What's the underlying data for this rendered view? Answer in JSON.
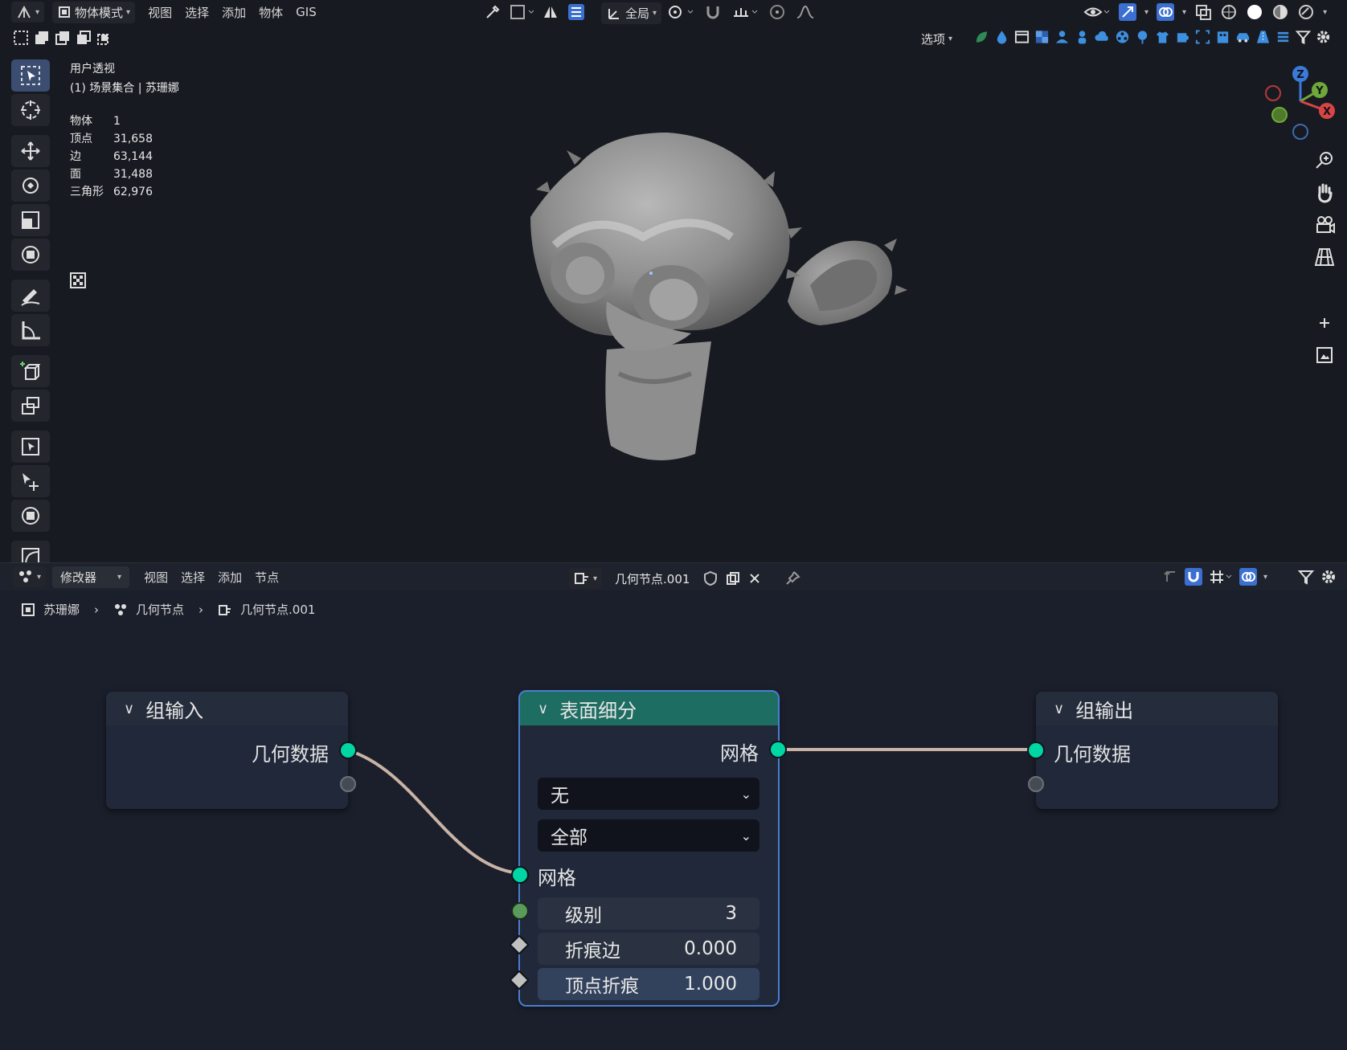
{
  "viewport_header": {
    "mode_label": "物体模式",
    "menus": [
      "视图",
      "选择",
      "添加",
      "物体",
      "GIS"
    ],
    "transform_orientation": "全局",
    "options_label": "选项"
  },
  "viewport": {
    "view_name": "用户透视",
    "collection_line": "(1) 场景集合 | 苏珊娜",
    "stats": [
      {
        "label": "物体",
        "value": "1"
      },
      {
        "label": "顶点",
        "value": "31,658"
      },
      {
        "label": "边",
        "value": "63,144"
      },
      {
        "label": "面",
        "value": "31,488"
      },
      {
        "label": "三角形",
        "value": "62,976"
      }
    ],
    "gizmo_axes": {
      "x": "X",
      "y": "Y",
      "z": "Z"
    }
  },
  "node_header": {
    "editor_type_label": "修改器",
    "menus": [
      "视图",
      "选择",
      "添加",
      "节点"
    ],
    "node_tree_name": "几何节点.001"
  },
  "breadcrumb": {
    "object": "苏珊娜",
    "modifier": "几何节点",
    "tree": "几何节点.001"
  },
  "nodes": {
    "group_input": {
      "title": "组输入",
      "output": "几何数据"
    },
    "subdivide": {
      "title": "表面细分",
      "output": "网格",
      "uv_smooth": "无",
      "boundary_smooth": "全部",
      "input_mesh": "网格",
      "level_label": "级别",
      "level_value": "3",
      "edge_crease_label": "折痕边",
      "edge_crease_value": "0.000",
      "vertex_crease_label": "顶点折痕",
      "vertex_crease_value": "1.000"
    },
    "group_output": {
      "title": "组输出",
      "input": "几何数据"
    }
  },
  "colors": {
    "geometry_socket": "#00d6a3",
    "subdivide_header": "#1e6d62",
    "node_body": "#20283a",
    "link": "#c9b3a6",
    "selected_outline": "#4a7ed0"
  }
}
